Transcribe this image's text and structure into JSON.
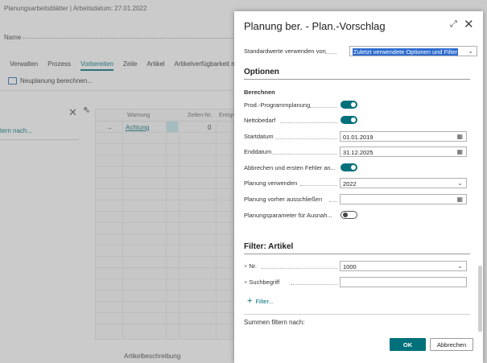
{
  "background": {
    "breadcrumb": "Planungsarbeitsblätter | Arbeitsdatum: 27.01.2022",
    "name_label": "Name",
    "actions": [
      "Verwalten",
      "Prozess",
      "Vorbereiten",
      "Zeile",
      "Artikel",
      "Artikelverfügbarkeit nach"
    ],
    "active_action": "Vorbereiten",
    "new_planning": "Neuplanung berechnen...",
    "filter_link": "tern nach...",
    "columns": [
      "Warnung",
      "Zeilen-Nr.",
      "Ereign"
    ],
    "row": {
      "arrow": "→",
      "warning": "Achtung",
      "line_no": "0"
    },
    "description_label": "Artikelbeschreibung"
  },
  "dialog": {
    "title": "Planung ber. - Plan.-Vorschlag",
    "defaults": {
      "label": "Standardwerte verwenden von",
      "value": "Zuletzt verwendete Optionen und Filter"
    },
    "options_title": "Optionen",
    "calc_subtitle": "Berechnen",
    "fields": {
      "prod_program": {
        "label": "Prod.-Programmplanung",
        "on": true
      },
      "net_demand": {
        "label": "Nettobedarf",
        "on": true
      },
      "start_date": {
        "label": "Startdatum",
        "value": "01.01.2019"
      },
      "end_date": {
        "label": "Enddatum",
        "value": "31.12.2025"
      },
      "abort_error": {
        "label": "Abbrechen und ersten Fehler an...",
        "on": true
      },
      "use_plan": {
        "label": "Planung verwenden",
        "value": "2022"
      },
      "exclude_plan": {
        "label": "Planung vorher ausschließen",
        "value": ""
      },
      "plan_params": {
        "label": "Planungsparameter für Ausnah...",
        "on": false
      }
    },
    "filter_title": "Filter: Artikel",
    "filter_no": {
      "label": "Nr.",
      "value": "1000"
    },
    "filter_search": {
      "label": "Suchbegriff",
      "value": ""
    },
    "filter_add": "Filter...",
    "sum_title": "Summen filtern nach:",
    "ok": "OK",
    "cancel": "Abbrechen"
  }
}
